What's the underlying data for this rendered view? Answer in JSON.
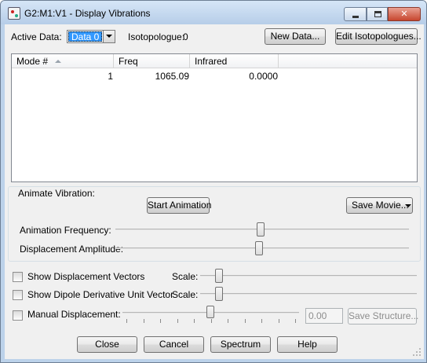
{
  "window": {
    "title": "G2:M1:V1 - Display Vibrations",
    "controls": {
      "minimize": "minimize",
      "maximize": "maximize",
      "close": "close"
    }
  },
  "top": {
    "active_data_label": "Active Data:",
    "active_data_value": "Data 0",
    "isotopologue_label": "Isotopologue:",
    "isotopologue_value": "0",
    "new_data_button": "New Data...",
    "edit_isotopologues_button": "Edit Isotopologues..."
  },
  "table": {
    "columns": [
      "Mode #",
      "Freq",
      "Infrared"
    ],
    "sorted_column": "Mode #",
    "rows": [
      {
        "mode": "1",
        "freq": "1065.09",
        "infrared": "0.0000"
      }
    ]
  },
  "animate": {
    "group_label": "Animate Vibration:",
    "start_button": "Start Animation",
    "save_movie_button": "Save Movie...",
    "frequency_label": "Animation Frequency:",
    "frequency_level": 0.5,
    "amplitude_label": "Displacement Amplitude:",
    "amplitude_level": 0.49
  },
  "options": {
    "show_displacement_vectors": {
      "label": "Show Displacement Vectors",
      "checked": false,
      "scale_label": "Scale:",
      "scale_level": 0.08
    },
    "show_dipole_vector": {
      "label": "Show Dipole Derivative Unit Vector",
      "checked": false,
      "scale_label": "Scale:",
      "scale_level": 0.08
    },
    "manual_displacement": {
      "label": "Manual Displacement:",
      "checked": false,
      "value": "0.00",
      "level": 0.5,
      "save_structure_button": "Save Structure..."
    }
  },
  "footer": {
    "close_button": "Close",
    "cancel_button": "Cancel",
    "spectrum_button": "Spectrum",
    "help_button": "Help"
  },
  "colors": {
    "selection": "#3399ff",
    "title_gradient_top": "#d6e6f7",
    "close_button_red": "#c7462e",
    "dialog_background": "#f0f0f0"
  }
}
